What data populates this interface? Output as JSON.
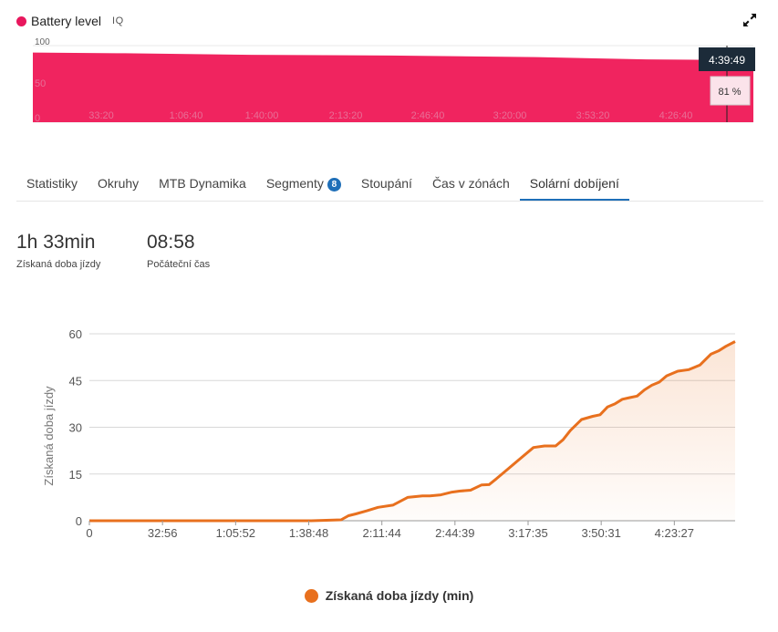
{
  "header": {
    "title": "Battery level",
    "badge": "IQ",
    "dot_color": "#e8175d"
  },
  "battery": {
    "y_ticks": [
      "100",
      "50",
      "0"
    ],
    "x_labels": [
      "33:20",
      "1:06:40",
      "1:40:00",
      "2:13:20",
      "2:46:40",
      "3:20:00",
      "3:53:20",
      "4:26:40"
    ],
    "tooltip_time": "4:39:49",
    "tooltip_value": "81 %",
    "fill_color": "#f0245f",
    "x_range": [
      0,
      17150
    ],
    "values": [
      [
        0,
        91
      ],
      [
        2200,
        90
      ],
      [
        5200,
        88
      ],
      [
        8500,
        87
      ],
      [
        12000,
        85
      ],
      [
        14600,
        82
      ],
      [
        17150,
        81
      ]
    ]
  },
  "tabs": [
    {
      "label": "Statistiky",
      "active": false,
      "badge": ""
    },
    {
      "label": "Okruhy",
      "active": false,
      "badge": ""
    },
    {
      "label": "MTB Dynamika",
      "active": false,
      "badge": ""
    },
    {
      "label": "Segmenty",
      "active": false,
      "badge": "8"
    },
    {
      "label": "Stoupání",
      "active": false,
      "badge": ""
    },
    {
      "label": "Čas v zónách",
      "active": false,
      "badge": ""
    },
    {
      "label": "Solární dobíjení",
      "active": true,
      "badge": ""
    }
  ],
  "badge_color": "#1f6fb8",
  "stats": [
    {
      "value": "1h 33min",
      "label": "Získaná doba jízdy"
    },
    {
      "value": "08:58",
      "label": "Počáteční čas"
    }
  ],
  "chart_data": {
    "type": "area",
    "title": "",
    "xlabel": "",
    "ylabel": "Získaná doba jízdy",
    "x_tick_labels": [
      "0",
      "32:56",
      "1:05:52",
      "1:38:48",
      "2:11:44",
      "2:44:39",
      "3:17:35",
      "3:50:31",
      "4:23:27"
    ],
    "x_tick_values": [
      0,
      1976,
      3952,
      5928,
      7904,
      9879,
      11855,
      13831,
      15807
    ],
    "y_ticks": [
      0,
      15,
      30,
      45,
      60
    ],
    "xlim": [
      0,
      17450
    ],
    "ylim": [
      0,
      60
    ],
    "grid": true,
    "color": "#e8701e",
    "series": [
      {
        "name": "Získaná doba jízdy (min)",
        "x": [
          0,
          3000,
          6000,
          6600,
          6800,
          7000,
          7200,
          7500,
          7800,
          8200,
          8600,
          9000,
          9200,
          9500,
          9800,
          10000,
          10300,
          10600,
          10800,
          11000,
          11300,
          11600,
          12000,
          12300,
          12600,
          12800,
          13000,
          13300,
          13600,
          13800,
          14000,
          14200,
          14400,
          14600,
          14800,
          15000,
          15200,
          15400,
          15600,
          15900,
          16200,
          16500,
          16800,
          17000,
          17200,
          17450
        ],
        "y": [
          0,
          0,
          0,
          0.2,
          0.3,
          1.6,
          2.2,
          3.2,
          4.3,
          5.0,
          7.5,
          8.0,
          8.0,
          8.3,
          9.2,
          9.5,
          9.8,
          11.5,
          11.6,
          13.5,
          16.5,
          19.5,
          23.5,
          24.0,
          24.0,
          26.0,
          29.0,
          32.5,
          33.5,
          34.0,
          36.5,
          37.5,
          39.0,
          39.5,
          40.0,
          42.0,
          43.5,
          44.5,
          46.5,
          48.0,
          48.5,
          50.0,
          53.5,
          54.5,
          56.0,
          57.5
        ]
      }
    ]
  }
}
